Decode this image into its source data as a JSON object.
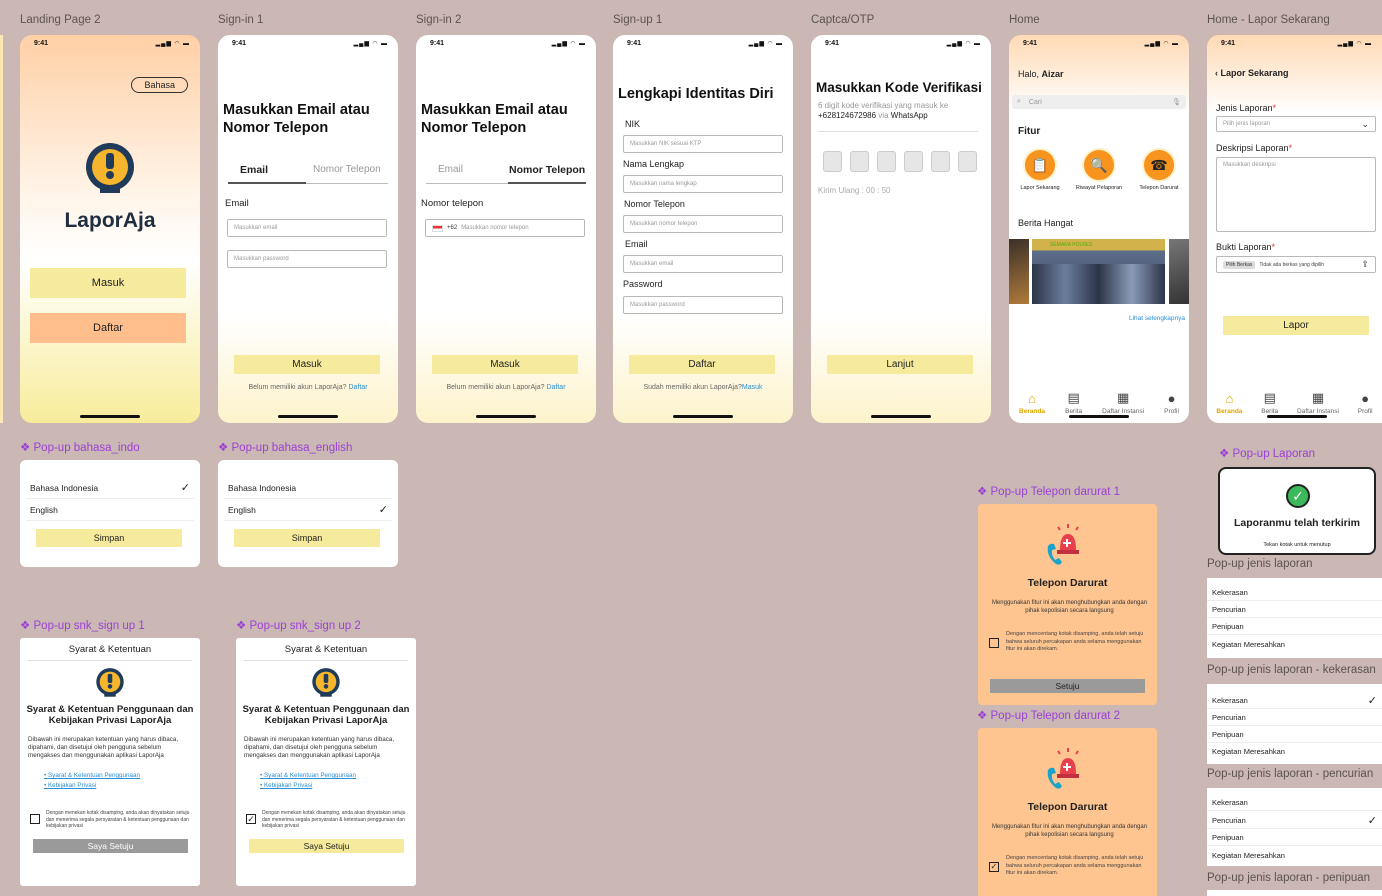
{
  "labels": {
    "landing": "Landing Page 2",
    "signin1": "Sign-in 1",
    "signin2": "Sign-in 2",
    "signup1": "Sign-up 1",
    "otp": "Captca/OTP",
    "home": "Home",
    "lapor": "Home - Lapor Sekarang"
  },
  "popup_labels": {
    "bahasa_indo": "❖ Pop-up bahasa_indo",
    "bahasa_english": "❖ Pop-up bahasa_english",
    "snk1": "❖ Pop-up snk_sign up 1",
    "snk2": "❖ Pop-up snk_sign up 2",
    "telp1": "❖ Pop-up Telepon darurat 1",
    "telp2": "❖ Pop-up Telepon darurat 2",
    "laporan": "❖ Pop-up Laporan"
  },
  "status": {
    "time": "9:41",
    "icons": "▂▄▆ ◠ ▬"
  },
  "landing": {
    "bahasa": "Bahasa",
    "app_name": "LaporAja",
    "masuk": "Masuk",
    "daftar": "Daftar"
  },
  "signin1": {
    "title": "Masukkan Email atau Nomor Telepon",
    "tab_email": "Email",
    "tab_phone": "Nomor Telepon",
    "field_label": "Email",
    "email_ph": "Masukkan email",
    "password_ph": "Masukkan password",
    "submit": "Masuk",
    "footer": "Belum memiliki akun LaporAja?",
    "footer_link": "Daftar"
  },
  "signin2": {
    "title": "Masukkan Email atau Nomor Telepon",
    "tab_email": "Email",
    "tab_phone": "Nomor Telepon",
    "field_label": "Nomor telepon",
    "prefix": "+62",
    "phone_ph": "Masukkan nomor telepon",
    "submit": "Masuk",
    "footer": "Belum memiliki akun LaporAja?",
    "footer_link": "Daftar"
  },
  "signup1": {
    "title": "Lengkapi Identitas Diri",
    "nik": "NIK",
    "nik_ph": "Masukkan NIK sesuai KTP",
    "nama": "Nama Lengkap",
    "nama_ph": "Masukkan nama lengkap",
    "telp": "Nomor Telepon",
    "telp_ph": "Masukkan nomor telepon",
    "email": "Email",
    "email_ph": "Masukkan email",
    "password": "Password",
    "password_ph": "Masukkan password",
    "submit": "Daftar",
    "footer": "Sudah memiliki akun LaporAja?",
    "footer_link": "Masuk"
  },
  "otp": {
    "title": "Masukkan Kode Verifikasi",
    "desc": "6 digit kode verifikasi yang masuk ke",
    "phone": "+628124672986",
    "via": "via",
    "channel": "WhatsApp",
    "resend": "Kirim Ulang : 00 : 50",
    "submit": "Lanjut"
  },
  "home": {
    "greeting": "Halo,",
    "name": "Aizar",
    "search_ph": "Cari",
    "fitur": "Fitur",
    "features": [
      "Lapor Sekarang",
      "Riwayat Pelaporan",
      "Telepon Darurat"
    ],
    "berita": "Berita Hangat",
    "more": "Lihat selengkapnya",
    "banner": "SEMARA POLRES"
  },
  "nav": {
    "beranda": "Beranda",
    "berita": "Berita",
    "instansi": "Daftar Instansi",
    "profil": "Profil"
  },
  "lapor": {
    "back": "Lapor Sekarang",
    "jenis": "Jenis Laporan",
    "jenis_ph": "Pilih jenis laporan",
    "desk": "Deskripsi Laporan",
    "desk_ph": "Masukkan deskripsi",
    "bukti": "Bukti Laporan",
    "file_btn": "Pilih Berkas",
    "file_text": "Tidak ada berkas yang dipilih",
    "submit": "Lapor",
    "star": "*"
  },
  "bahasa": {
    "indo": "Bahasa Indonesia",
    "english": "English",
    "save": "Simpan"
  },
  "snk": {
    "header": "Syarat & Ketentuan",
    "title": "Syarat & Ketentuan Penggunaan dan Kebijakan Privasi LaporAja",
    "body": "Dibawah ini merupakan ketentuan yang harus dibaca, dipahami, dan disetujui oleh pengguna sebelum mengakses dan menggunakan aplikasi LaporAja",
    "link1": "Syarat & Ketentuan Penggunaan",
    "link2": "Kebijakan Privasi",
    "consent": "Dengan menekan kotak disamping, anda akan dinyatakan setuju dan menerima segala persyaratan & ketentuan penggunaan dan kebijakan privasi",
    "agree": "Saya Setuju"
  },
  "telp": {
    "title": "Telepon Darurat",
    "desc": "Menggunakan fitur ini akan menghubungkan anda dengan pihak kepolisian secara langsung",
    "consent": "Dengan mencentang kotak disamping, anda telah setuju bahwa seluruh percakapan anda selama menggunakan fitur ini akan direkam.",
    "agree": "Setuju"
  },
  "laporan_popup": {
    "title": "Laporanmu telah terkirim",
    "sub": "Tekan kotak untuk menutup"
  },
  "jenis_popups": {
    "label1": "Pop-up jenis laporan",
    "label2": "Pop-up jenis laporan - kekerasan",
    "label3": "Pop-up jenis laporan - pencurian",
    "label4": "Pop-up jenis laporan - penipuan",
    "items": [
      "Kekerasan",
      "Pencurian",
      "Penipuan",
      "Kegiatan Meresahkan"
    ]
  },
  "colors": {
    "background": "#cbb8b5",
    "button_yellow": "#f6ea9c",
    "button_orange": "#ffbe8c",
    "popup_orange": "#ffc591",
    "accent_purple": "#9b3fd6",
    "link": "#2a8fd6"
  }
}
